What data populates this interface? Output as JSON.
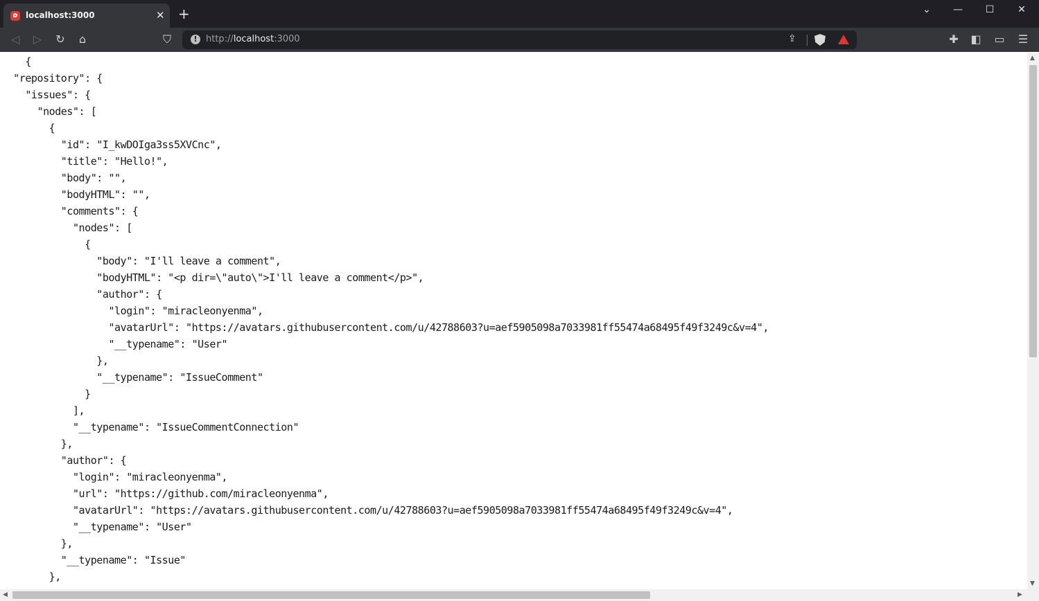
{
  "browser": {
    "tab_title": "localhost:3000",
    "tab_close_glyph": "✕",
    "new_tab_glyph": "+",
    "window_controls": {
      "dropdown": "⌄",
      "minimize": "—",
      "maximize": "☐",
      "close": "✕"
    },
    "url": {
      "scheme": "http://",
      "host": "localhost",
      "port": ":3000"
    },
    "toolbar_icons": [
      "back-icon",
      "forward-icon",
      "reload-icon",
      "home-icon",
      "bookmark-icon",
      "share-icon",
      "brave-shields-icon",
      "brave-rewards-icon",
      "extensions-icon",
      "sidebar-icon",
      "wallet-icon",
      "menu-icon"
    ],
    "accent": "#e8363a"
  },
  "page": {
    "json_text": "    {\n  \"repository\": {\n    \"issues\": {\n      \"nodes\": [\n        {\n          \"id\": \"I_kwDOIga3ss5XVCnc\",\n          \"title\": \"Hello!\",\n          \"body\": \"\",\n          \"bodyHTML\": \"\",\n          \"comments\": {\n            \"nodes\": [\n              {\n                \"body\": \"I'll leave a comment\",\n                \"bodyHTML\": \"<p dir=\\\"auto\\\">I'll leave a comment</p>\",\n                \"author\": {\n                  \"login\": \"miracleonyenma\",\n                  \"avatarUrl\": \"https://avatars.githubusercontent.com/u/42788603?u=aef5905098a7033981ff55474a68495f49f3249c&v=4\",\n                  \"__typename\": \"User\"\n                },\n                \"__typename\": \"IssueComment\"\n              }\n            ],\n            \"__typename\": \"IssueCommentConnection\"\n          },\n          \"author\": {\n            \"login\": \"miracleonyenma\",\n            \"url\": \"https://github.com/miracleonyenma\",\n            \"avatarUrl\": \"https://avatars.githubusercontent.com/u/42788603?u=aef5905098a7033981ff55474a68495f49f3249c&v=4\",\n            \"__typename\": \"User\"\n          },\n          \"__typename\": \"Issue\"\n        },"
  },
  "scroll": {
    "vertical_position": 0.02,
    "horizontal_position": 0.0
  }
}
